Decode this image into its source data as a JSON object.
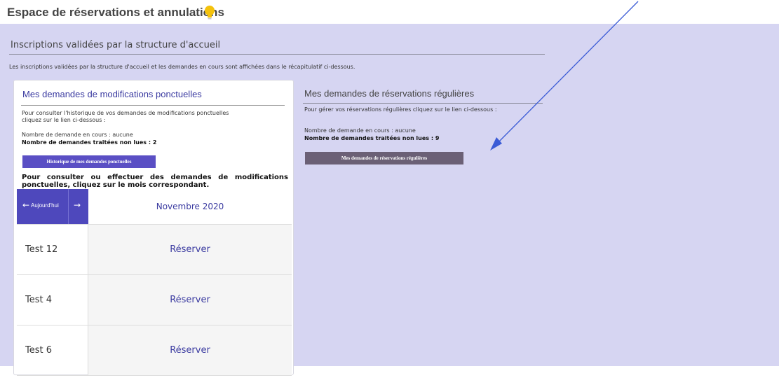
{
  "header": {
    "title": "Espace de réservations et annulations",
    "icon": "lightbulb-icon"
  },
  "section": {
    "title": "Inscriptions validées par la structure d'accueil",
    "description": "Les inscriptions validées par la structure d'accueil et les demandes en cours  sont affichées dans le récapitulatif ci-dessous."
  },
  "ponctuelles": {
    "title": "Mes demandes de modifications ponctuelles",
    "intro_line1": "Pour consulter l'historique de vos demandes de modifications ponctuelles",
    "intro_line2": "cliquez sur le lien ci-dessous :",
    "pending": "Nombre de demande en cours : aucune",
    "unread": "Nombre de demandes traitées non lues : 2",
    "history_button": "Historique de mes demandes ponctuelles",
    "instruction": "Pour consulter ou effectuer des demandes de modifications ponctuelles, cliquez sur le mois correspondant."
  },
  "calendar": {
    "prev_icon": "←",
    "today_label": "Aujourd'hui",
    "next_icon": "→",
    "month": "Novembre 2020",
    "rows": [
      {
        "name": "Test 12",
        "action": "Réserver"
      },
      {
        "name": "Test 4",
        "action": "Réserver"
      },
      {
        "name": "Test 6",
        "action": "Réserver"
      }
    ]
  },
  "regulieres": {
    "title": "Mes demandes de réservations régulières",
    "intro": "Pour gérer vos réservations régulières cliquez sur le lien ci-dessous :",
    "pending": "Nombre de demande en cours : aucune",
    "unread": "Nombre de demandes traitées non lues : 9",
    "button": "Mes demandes de réservations régulières"
  },
  "colors": {
    "background": "#d6d5f2",
    "accent": "#4e48bc",
    "gray_button": "#6b6076",
    "annotation_arrow": "#3b5bd6"
  }
}
